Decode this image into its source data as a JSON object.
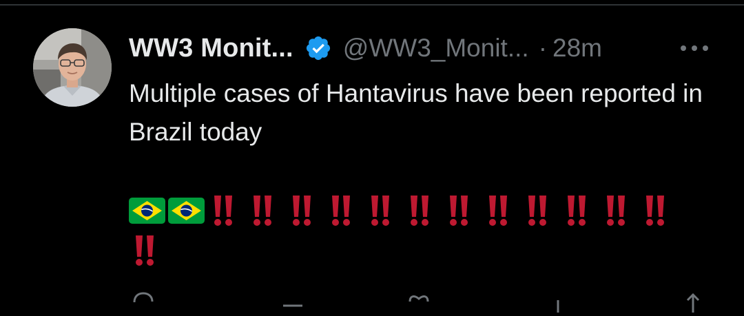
{
  "tweet": {
    "display_name": "WW3 Monit...",
    "handle": "@WW3_Monit...",
    "separator": "·",
    "timestamp": "28m",
    "text": "Multiple cases of Hantavirus have been reported in Brazil today",
    "verified": true,
    "flags": [
      "brazil-flag-icon",
      "brazil-flag-icon"
    ],
    "exclamation_count": 13
  },
  "colors": {
    "background": "#000000",
    "primary_text": "#e7e9ea",
    "secondary_text": "#71767b",
    "verified_blue": "#1d9bf0",
    "exclamation_red": "#be1931",
    "divider": "#2f3336"
  },
  "icons": {
    "more": "more-horizontal-icon",
    "verified": "verified-badge-icon",
    "actions": [
      "reply-icon",
      "repost-icon",
      "like-icon",
      "views-icon",
      "share-icon"
    ]
  }
}
